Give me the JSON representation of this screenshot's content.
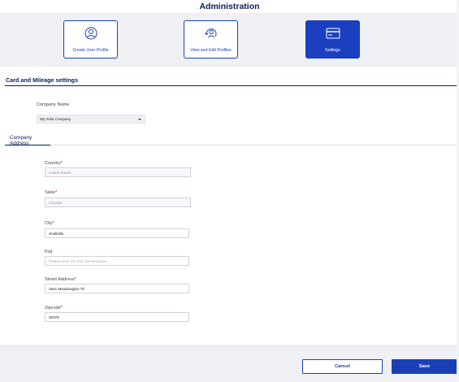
{
  "header": {
    "title": "Administration"
  },
  "tiles": [
    {
      "label": "Create User Profile",
      "icon": "user-profile-icon"
    },
    {
      "label": "View and Edit Profiles",
      "icon": "user-edit-icon"
    },
    {
      "label": "Settings",
      "icon": "credit-card-icon",
      "active": true
    }
  ],
  "section": {
    "title": "Card and Mileage settings"
  },
  "company": {
    "label": "Company Name",
    "selected": "My Irelia Company"
  },
  "tabs": [
    {
      "label": "Company Address",
      "active": true
    }
  ],
  "form": {
    "country": {
      "label": "Country",
      "value": "United States"
    },
    "state": {
      "label": "State",
      "value": "Georgia"
    },
    "city": {
      "label": "City",
      "value": "Snellville"
    },
    "flat": {
      "label": "Flat",
      "placeholder": "Please enter the Flat name/number"
    },
    "street": {
      "label": "Street Address",
      "value": "2541 Meadowglen Trl"
    },
    "zipcode": {
      "label": "Zipcode",
      "value": "30078"
    },
    "required_mark": "*"
  },
  "footer": {
    "cancel_label": "Cancel",
    "save_label": "Save"
  },
  "colors": {
    "accent": "#1b3fb5",
    "heading": "#0a1f5c",
    "required": "#d0021b"
  }
}
